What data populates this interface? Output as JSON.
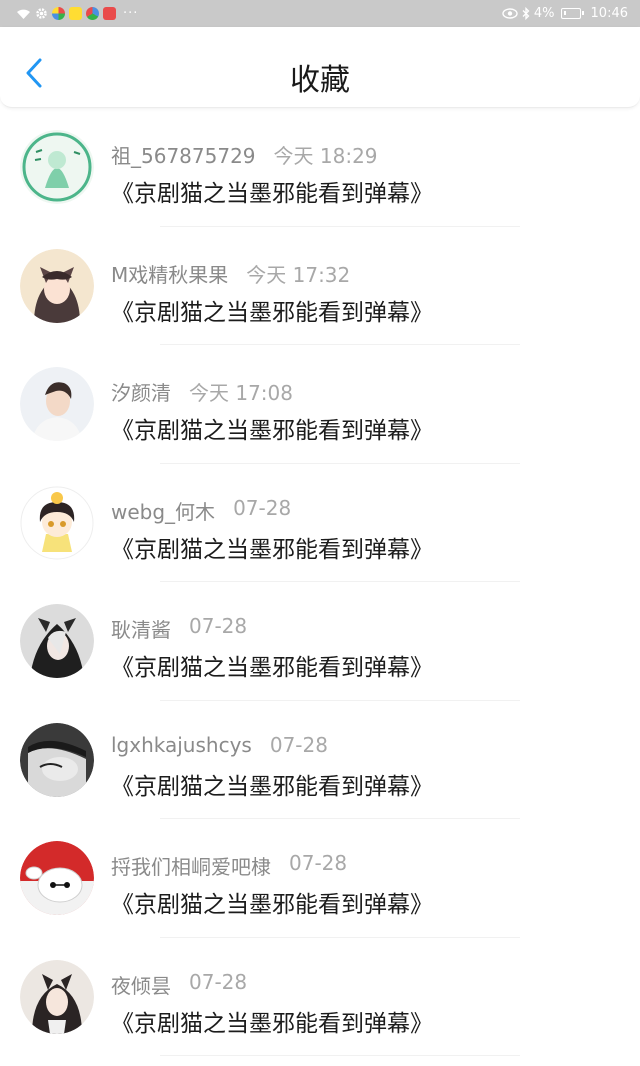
{
  "status_bar": {
    "battery_percent": "4%",
    "clock": "10:46",
    "overflow": "···",
    "app_colors": [
      "#4a90e2",
      "#ffdd33",
      "#35b24a",
      "#e94b4b"
    ]
  },
  "header": {
    "title": "收藏",
    "accent_color": "#2196f3"
  },
  "items": [
    {
      "username": "祖_567875729",
      "time": "今天 18:29",
      "content": "《京剧猫之当墨邪能看到弹幕》"
    },
    {
      "username": "M戏精秋果果",
      "time": "今天 17:32",
      "content": "《京剧猫之当墨邪能看到弹幕》"
    },
    {
      "username": "汐颜清",
      "time": "今天 17:08",
      "content": "《京剧猫之当墨邪能看到弹幕》"
    },
    {
      "username": "webg_何木",
      "time": "07-28",
      "content": "《京剧猫之当墨邪能看到弹幕》"
    },
    {
      "username": "耿清酱",
      "time": "07-28",
      "content": "《京剧猫之当墨邪能看到弹幕》"
    },
    {
      "username": "lgxhkajushcys",
      "time": "07-28",
      "content": "《京剧猫之当墨邪能看到弹幕》"
    },
    {
      "username": "捋我们相峒爱吧棣",
      "time": "07-28",
      "content": "《京剧猫之当墨邪能看到弹幕》"
    },
    {
      "username": "夜倾昙",
      "time": "07-28",
      "content": "《京剧猫之当墨邪能看到弹幕》"
    }
  ]
}
